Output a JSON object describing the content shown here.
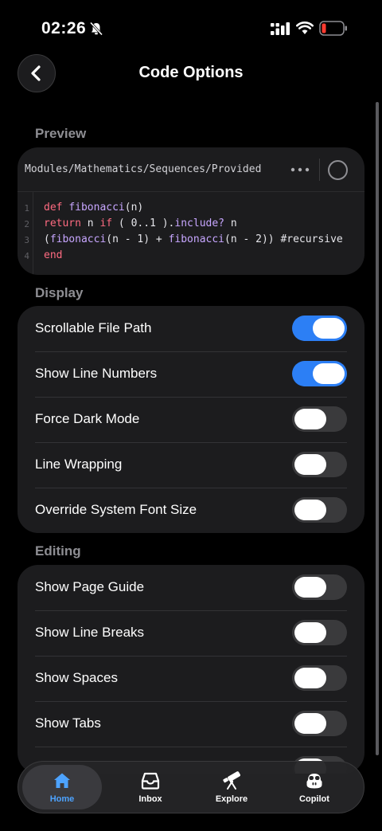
{
  "status_bar": {
    "time": "02:26"
  },
  "header": {
    "title": "Code Options"
  },
  "sections": {
    "preview": "Preview",
    "display": "Display",
    "editing": "Editing"
  },
  "preview": {
    "file_path": "Modules/Mathematics/Sequences/Provided",
    "line_numbers": [
      "1",
      "2",
      "3",
      "4"
    ]
  },
  "display": {
    "items": [
      {
        "label": "Scrollable File Path",
        "on": true
      },
      {
        "label": "Show Line Numbers",
        "on": true
      },
      {
        "label": "Force Dark Mode",
        "on": false
      },
      {
        "label": "Line Wrapping",
        "on": false
      },
      {
        "label": "Override System Font Size",
        "on": false
      }
    ]
  },
  "editing": {
    "items": [
      {
        "label": "Show Page Guide",
        "on": false
      },
      {
        "label": "Show Line Breaks",
        "on": false
      },
      {
        "label": "Show Spaces",
        "on": false
      },
      {
        "label": "Show Tabs",
        "on": false
      }
    ]
  },
  "tab_bar": {
    "items": [
      {
        "label": "Home",
        "icon": "home-icon",
        "active": true
      },
      {
        "label": "Inbox",
        "icon": "inbox-icon",
        "active": false
      },
      {
        "label": "Explore",
        "icon": "telescope-icon",
        "active": false
      },
      {
        "label": "Copilot",
        "icon": "copilot-icon",
        "active": false
      }
    ]
  },
  "colors": {
    "accent": "#2c7ff5",
    "active_tab_label": "#4da3ff",
    "keyword": "#ff6b81",
    "function": "#c7a6ff"
  }
}
